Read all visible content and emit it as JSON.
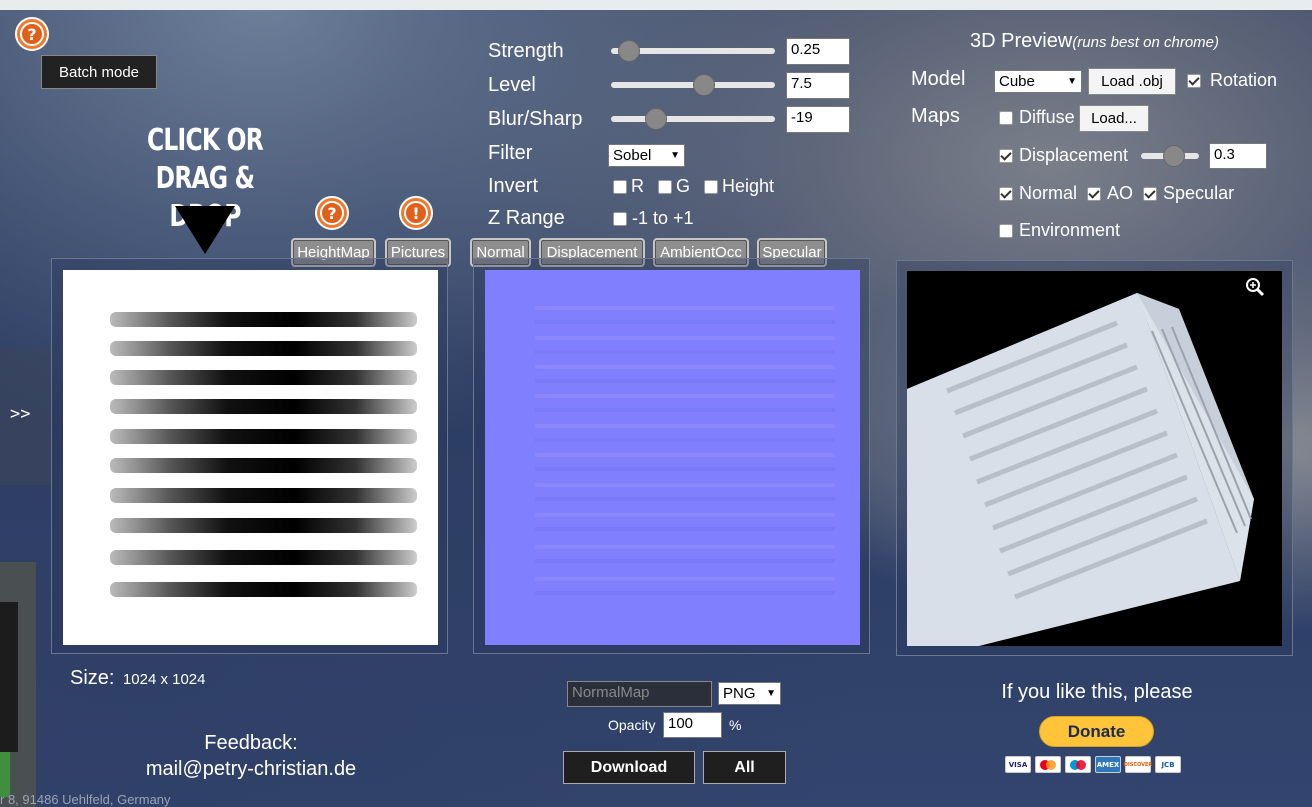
{
  "batch_mode_label": "Batch mode",
  "drop_hint": {
    "line1": "CLICK OR",
    "line2": "DRAG & DROP"
  },
  "left_tabs": [
    "HeightMap",
    "Pictures"
  ],
  "right_tabs": [
    "Normal",
    "Displacement",
    "AmbientOcc",
    "Specular"
  ],
  "controls": {
    "strength": {
      "label": "Strength",
      "value": "0.25",
      "fraction": 0.05
    },
    "level": {
      "label": "Level",
      "value": "7.5",
      "fraction": 0.58
    },
    "blur_sharp": {
      "label": "Blur/Sharp",
      "value": "-19",
      "fraction": 0.24
    },
    "filter": {
      "label": "Filter",
      "value": "Sobel"
    },
    "invert": {
      "label": "Invert",
      "options": [
        "R",
        "G",
        "Height"
      ]
    },
    "z_range": {
      "label": "Z Range",
      "option": "-1 to +1"
    }
  },
  "preview": {
    "title": "3D Preview",
    "note": "(runs best on chrome)",
    "model_label": "Model",
    "model_value": "Cube",
    "load_obj": "Load .obj",
    "rotation": "Rotation",
    "maps_label": "Maps",
    "diffuse": "Diffuse",
    "load": "Load...",
    "displacement": "Displacement",
    "displacement_value": "0.3",
    "displacement_fraction": 0.62,
    "normal": "Normal",
    "ao": "AO",
    "specular": "Specular",
    "environment": "Environment"
  },
  "size_label": "Size:",
  "size_value": "1024 x 1024",
  "feedback_label": "Feedback:",
  "feedback_email": "mail@petry-christian.de",
  "footer_address": "r 8, 91486 Uehlfeld, Germany",
  "export": {
    "filename_placeholder": "NormalMap",
    "format": "PNG",
    "opacity_label": "Opacity",
    "opacity_value": "100",
    "percent": "%",
    "download": "Download",
    "all": "All"
  },
  "donate": {
    "text": "If you like this, please",
    "button": "Donate",
    "cards": [
      "VISA",
      "MC",
      "Maestro",
      "AMEX",
      "DISCOVER",
      "JCB"
    ]
  },
  "side_arrows": {
    "left": ">>"
  },
  "colors": {
    "normal_map": "#8080ff",
    "help_icon": "#f07a2a",
    "donate_button": "#ffc439"
  }
}
